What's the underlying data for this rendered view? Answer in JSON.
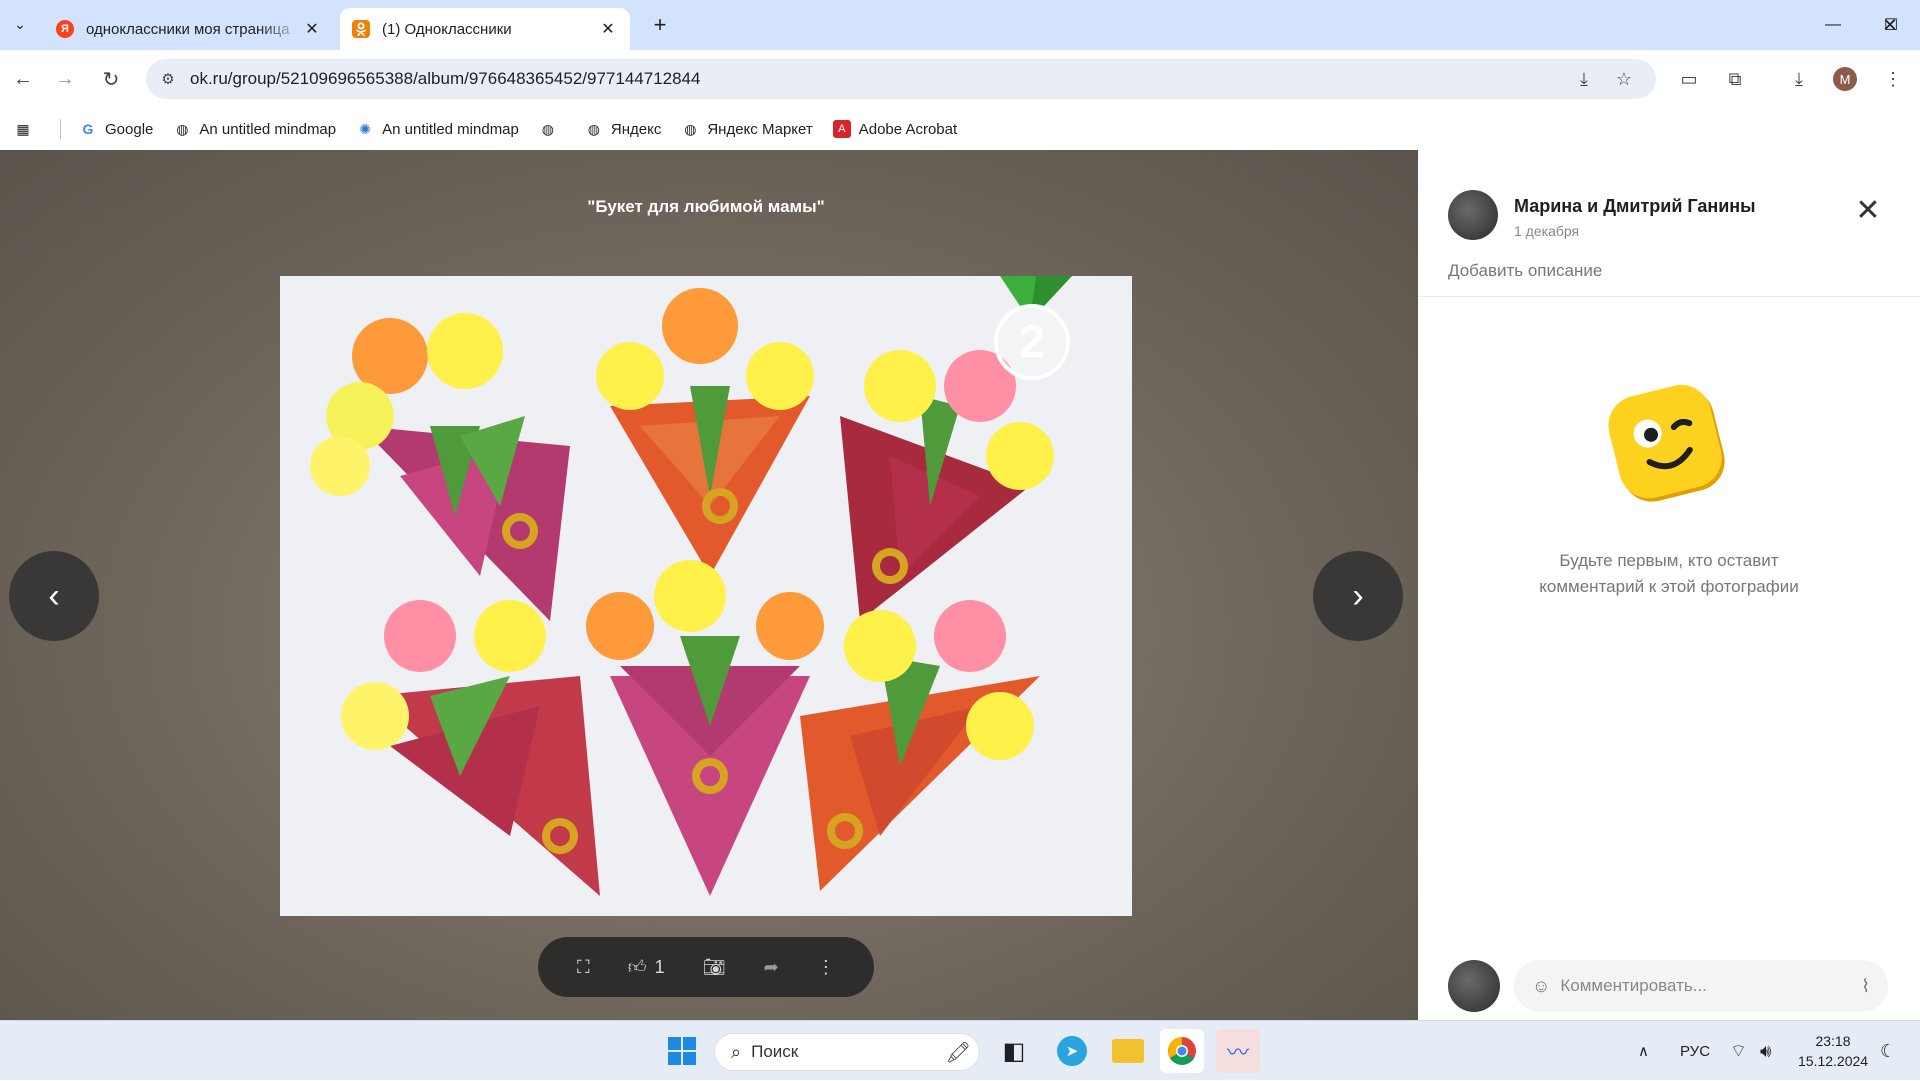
{
  "browser": {
    "tabs": [
      {
        "title": "одноклассники моя страница",
        "favicon": "yandex-favicon",
        "active": false
      },
      {
        "title": "(1) Одноклассники",
        "favicon": "ok-favicon",
        "active": true
      }
    ],
    "url": "ok.ru/group/52109696565388/album/976648365452/977144712844",
    "profile_initial": "M",
    "bookmarks": [
      {
        "label": "Google",
        "icon": "google-icon"
      },
      {
        "label": "An untitled mindmap",
        "icon": "globe-icon"
      },
      {
        "label": "An untitled mindmap",
        "icon": "mindmap-icon"
      },
      {
        "label": "",
        "icon": "globe-icon"
      },
      {
        "label": "Яндекс",
        "icon": "globe-icon"
      },
      {
        "label": "Яндекс Маркет",
        "icon": "globe-icon"
      },
      {
        "label": "Adobe Acrobat",
        "icon": "acrobat-icon"
      }
    ]
  },
  "viewer": {
    "photo_title": "\"Букет для любимой мамы\"",
    "badge_number": "2",
    "likes_count": "1"
  },
  "panel": {
    "author_name": "Марина и Дмитрий Ганины",
    "date": "1 декабря",
    "add_description": "Добавить описание",
    "empty_line1": "Будьте первым, кто оставит",
    "empty_line2": "комментарий к этой фотографии",
    "comment_placeholder": "Комментировать..."
  },
  "taskbar": {
    "search_label": "Поиск",
    "language": "РУС",
    "time": "23:18",
    "date": "15.12.2024"
  },
  "colors": {
    "tabbar_bg": "#d3e3fd",
    "ok_orange": "#ee8208",
    "viewer_bg": "#6f675c",
    "smiley_yellow": "#ffd21f"
  }
}
